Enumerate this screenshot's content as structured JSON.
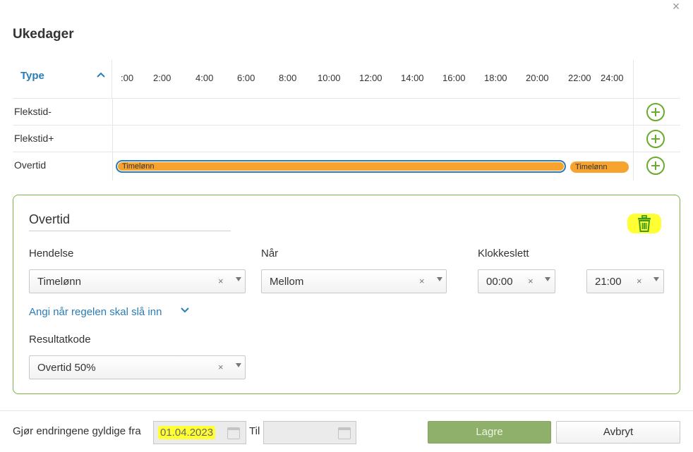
{
  "dialog": {
    "title": "Ukedager",
    "close_icon": "close-icon"
  },
  "timeline": {
    "type_header": "Type",
    "hours": [
      ":00",
      "2:00",
      "4:00",
      "6:00",
      "8:00",
      "10:00",
      "12:00",
      "14:00",
      "16:00",
      "18:00",
      "20:00",
      "22:00",
      "24:00"
    ],
    "rows": [
      {
        "name": "Flekstid-",
        "bars": []
      },
      {
        "name": "Flekstid+",
        "bars": []
      },
      {
        "name": "Overtid",
        "bars": [
          {
            "label": "Timelønn",
            "start": "00:00",
            "end": "21:00",
            "selected": true
          },
          {
            "label": "Timelønn",
            "start": "21:00",
            "end": "24:00",
            "selected": false
          }
        ]
      }
    ],
    "bar_color": "#f7a330",
    "add_icon": "plus-circle-icon"
  },
  "panel": {
    "title": "Overtid",
    "delete_icon": "trash-icon",
    "hendelse": {
      "label": "Hendelse",
      "value": "Timelønn"
    },
    "naar": {
      "label": "Når",
      "value": "Mellom"
    },
    "klokkeslett": {
      "label": "Klokkeslett",
      "from": "00:00",
      "to": "21:00"
    },
    "link": "Angi når regelen skal slå inn",
    "resultatkode": {
      "label": "Resultatkode",
      "value": "Overtid 50%"
    },
    "clear_symbol": "×"
  },
  "footer": {
    "valid_label": "Gjør endringene gyldige fra",
    "from_date": "01.04.2023",
    "til_label": "Til",
    "to_date": "",
    "save_label": "Lagre",
    "cancel_label": "Avbryt"
  },
  "colors": {
    "accent_blue": "#2a7db6",
    "green": "#6aaa2e",
    "highlight": "#ffff33"
  }
}
